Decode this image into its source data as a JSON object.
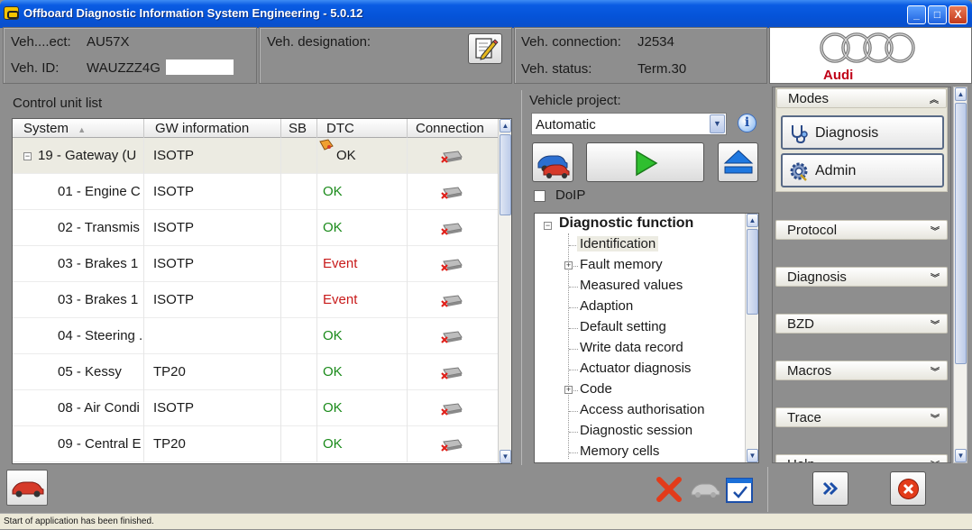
{
  "window": {
    "title": "Offboard Diagnostic Information System Engineering - 5.0.12",
    "minimize": "_",
    "maximize": "□",
    "close": "X"
  },
  "header": {
    "veh_project_label": "Veh....ect:",
    "veh_project_value": "AU57X",
    "veh_id_label": "Veh. ID:",
    "veh_id_value": "WAUZZZ4G",
    "veh_designation_label": "Veh. designation:",
    "veh_connection_label": "Veh. connection:",
    "veh_connection_value": "J2534",
    "veh_status_label": "Veh. status:",
    "veh_status_value": "Term.30",
    "brand": "Audi"
  },
  "control_units": {
    "title": "Control unit list",
    "columns": [
      "System",
      "GW information",
      "SB",
      "DTC",
      "Connection"
    ],
    "rows": [
      {
        "system": "19 - Gateway  (U",
        "gw": "ISOTP",
        "sb": "",
        "dtc": "OK",
        "status": "neutral"
      },
      {
        "system": "01 - Engine C",
        "gw": "ISOTP",
        "sb": "",
        "dtc": "OK",
        "status": "ok"
      },
      {
        "system": "02 - Transmis",
        "gw": "ISOTP",
        "sb": "",
        "dtc": "OK",
        "status": "ok"
      },
      {
        "system": "03 - Brakes 1",
        "gw": "ISOTP",
        "sb": "",
        "dtc": "Event",
        "status": "event"
      },
      {
        "system": "03 - Brakes 1",
        "gw": "ISOTP",
        "sb": "",
        "dtc": "Event",
        "status": "event"
      },
      {
        "system": "04 - Steering ...",
        "gw": "",
        "sb": "",
        "dtc": "OK",
        "status": "ok"
      },
      {
        "system": "05 - Kessy",
        "gw": "TP20",
        "sb": "",
        "dtc": "OK",
        "status": "ok"
      },
      {
        "system": "08 - Air Condi",
        "gw": "ISOTP",
        "sb": "",
        "dtc": "OK",
        "status": "ok"
      },
      {
        "system": "09 - Central E",
        "gw": "TP20",
        "sb": "",
        "dtc": "OK",
        "status": "ok"
      }
    ]
  },
  "vehicle_project": {
    "label": "Vehicle project:",
    "selected": "Automatic",
    "doip_label": "DoIP"
  },
  "tree": {
    "root": "Diagnostic function",
    "items": [
      "Identification",
      "Fault memory",
      "Measured values",
      "Adaption",
      "Default setting",
      "Write data record",
      "Actuator diagnosis",
      "Code",
      "Access authorisation",
      "Diagnostic session",
      "Memory cells"
    ]
  },
  "sidebar": {
    "modes_title": "Modes",
    "diagnosis_button": "Diagnosis",
    "admin_button": "Admin",
    "sections": [
      "Protocol",
      "Diagnosis",
      "BZD",
      "Macros",
      "Trace",
      "Help"
    ]
  },
  "status": {
    "message": "Start of application has been finished."
  },
  "colors": {
    "titlebar": "#0553d8",
    "dtc_ok": "#1a8a1a",
    "dtc_event": "#c81a1a",
    "brand_red": "#c00018"
  }
}
